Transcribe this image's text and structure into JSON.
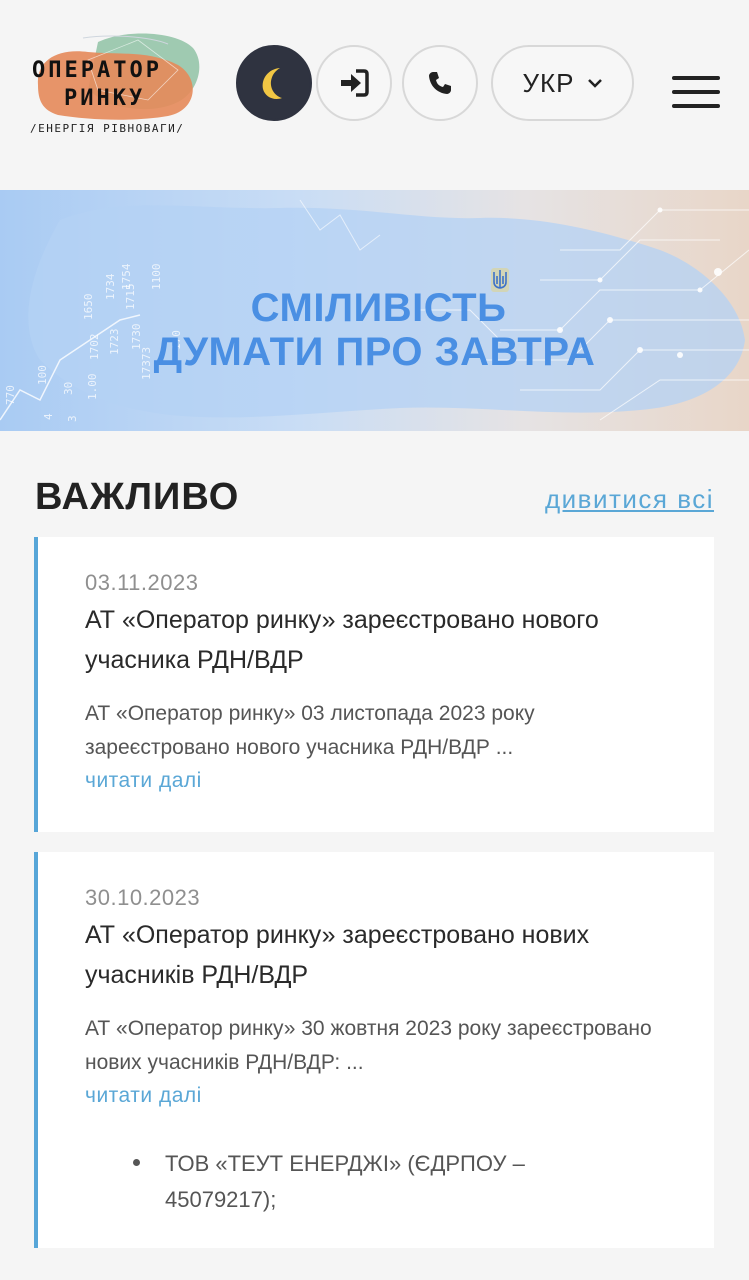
{
  "header": {
    "logo": {
      "line1": "ОПЕРАТОР",
      "line2": "РИНКУ",
      "tagline": "/ЕНЕРГІЯ РІВНОВАГИ/"
    },
    "theme_icon": "moon-icon",
    "login_icon": "sign-in-icon",
    "phone_icon": "phone-icon",
    "language": "УКР",
    "menu_icon": "hamburger-icon"
  },
  "banner": {
    "line1": "СМІЛИВІСТЬ",
    "line2": "ДУМАТИ ПРО ЗАВТРА",
    "numbers": [
      "1650",
      "1734",
      "1715",
      "1702",
      "1723",
      "100",
      "30",
      "770",
      "4",
      "3",
      "1100",
      "170",
      "1730",
      "1754",
      "17373",
      "1.00"
    ]
  },
  "important": {
    "title": "ВАЖЛИВО",
    "see_all": "дивитися всі",
    "items": [
      {
        "date": "03.11.2023",
        "title": "АТ «Оператор ринку» зареєстровано нового учасника РДН/ВДР",
        "excerpt": "АТ «Оператор ринку» 03 листопада 2023 року зареєстровано нового учасника РДН/ВДР ...",
        "more": "читати далі"
      },
      {
        "date": "30.10.2023",
        "title": "АТ «Оператор ринку» зареєстровано нових учасників РДН/ВДР",
        "excerpt": "АТ «Оператор ринку» 30 жовтня 2023 року зареєстровано нових учасників РДН/ВДР: ...",
        "more": "читати далі",
        "bullets": [
          "ТОВ «ТЕУТ ЕНЕРДЖІ» (ЄДРПОУ – 45079217);"
        ]
      }
    ]
  },
  "colors": {
    "accent": "#57a6d8",
    "banner_text": "#4a8fe3",
    "theme_button": "#2f3340",
    "moon": "#f2c744",
    "logo_orange": "#e58a5a",
    "logo_green": "#8fc2a4"
  }
}
